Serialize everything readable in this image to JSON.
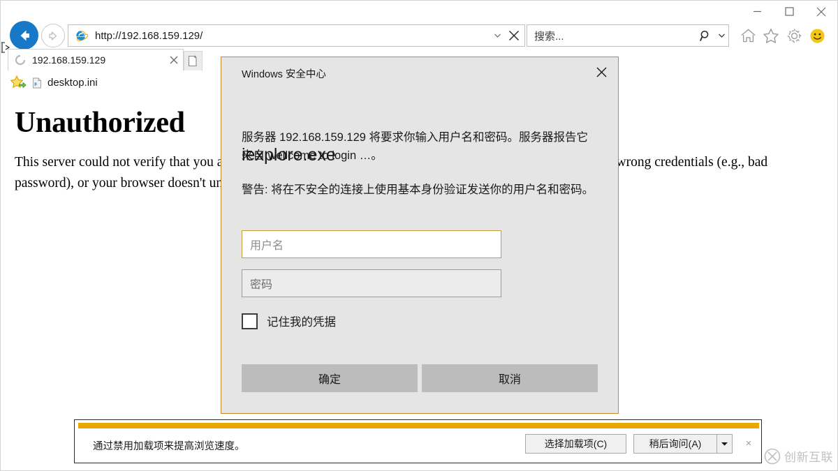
{
  "window": {
    "controls": {
      "minimize": "minimize-button",
      "maximize": "maximize-button",
      "close": "close-button"
    }
  },
  "navigation": {
    "back_label": "back",
    "forward_label": "forward",
    "url": "http://192.168.159.129/",
    "stop_label": "stop"
  },
  "search": {
    "placeholder": "搜索..."
  },
  "toolbar": {
    "home": "home-icon",
    "favorites": "favorites-icon",
    "settings": "settings-icon",
    "feedback": "feedback-icon"
  },
  "tabs": {
    "active": {
      "title": "192.168.159.129",
      "loading": true
    },
    "new_tab_label": "new tab"
  },
  "favorites_bar": {
    "items": [
      {
        "label": "desktop.ini"
      }
    ]
  },
  "page": {
    "heading": "Unauthorized",
    "body": "This server could not verify that you are authorized to access the document requested. Either you supplied the wrong credentials (e.g., bad password), or your browser doesn't understand how to supply the credentials required."
  },
  "notification": {
    "message": "通过禁用加载项来提高浏览速度。",
    "choose_addons_label": "选择加载项(C)",
    "ask_later_label": "稍后询问(A)",
    "dropdown_glyph": "▼",
    "close_glyph": "×",
    "accent_color": "#e8a800"
  },
  "dialog": {
    "title": "Windows 安全中心",
    "app_name": "iexplore.exe",
    "message": "服务器 192.168.159.129 将要求你输入用户名和密码。服务器报告它来自 wellcome to login …。",
    "warning": "警告: 将在不安全的连接上使用基本身份验证发送你的用户名和密码。",
    "username_placeholder": "用户名",
    "username_value": "",
    "password_placeholder": "密码",
    "password_value": "",
    "remember_label": "记住我的凭据",
    "remember_checked": false,
    "ok_label": "确定",
    "cancel_label": "取消",
    "border_color": "#c08a2e",
    "focus_color": "#c69a3e"
  },
  "watermark": {
    "text": "创新互联"
  }
}
